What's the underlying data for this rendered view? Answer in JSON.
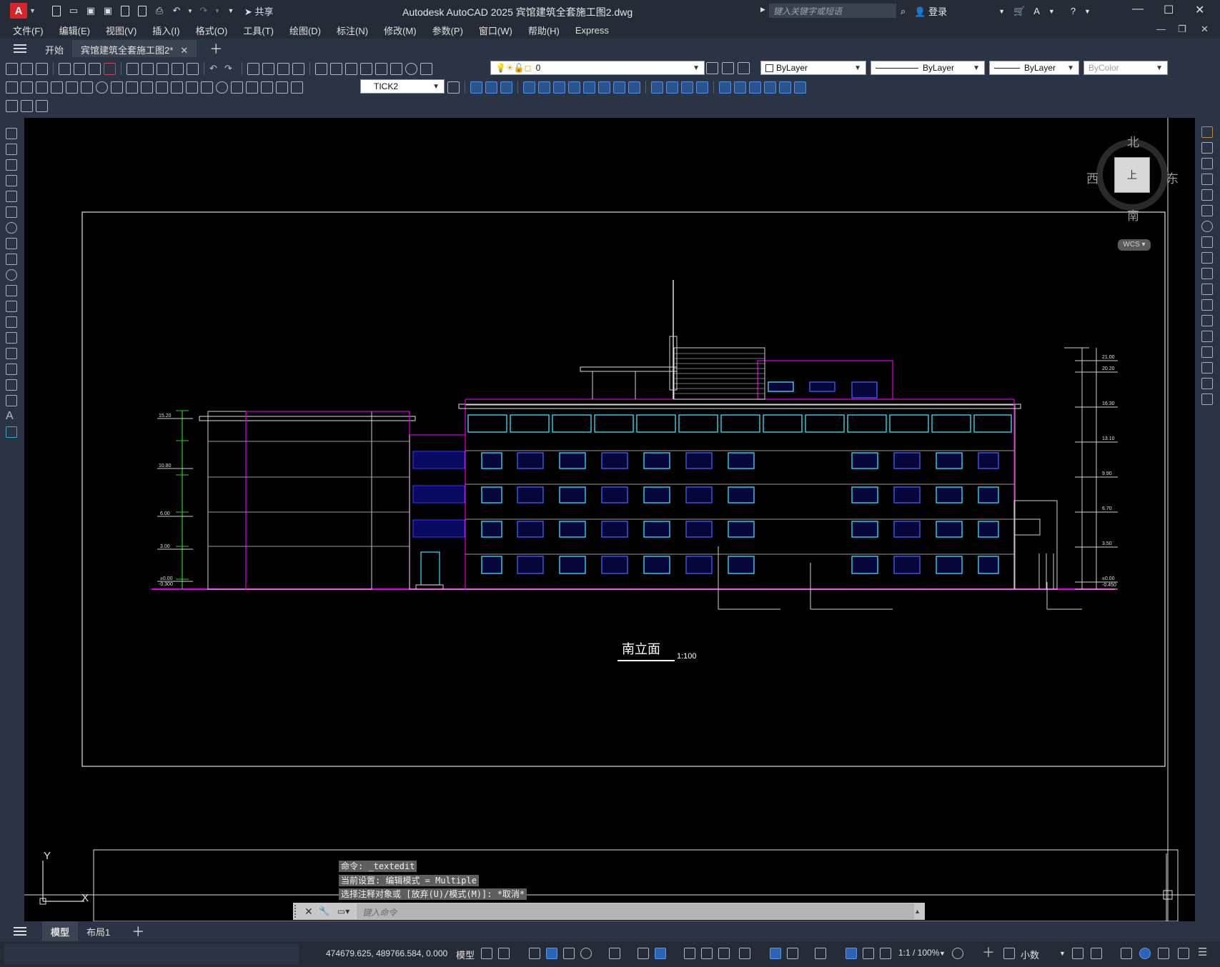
{
  "titlebar": {
    "app_logo": "A",
    "share": "共享",
    "title": "Autodesk AutoCAD 2025    宾馆建筑全套施工图2.dwg",
    "search_placeholder": "键入关键字或短语",
    "login": "登录"
  },
  "menu": [
    "文件(F)",
    "编辑(E)",
    "视图(V)",
    "插入(I)",
    "格式(O)",
    "工具(T)",
    "绘图(D)",
    "标注(N)",
    "修改(M)",
    "参数(P)",
    "窗口(W)",
    "帮助(H)",
    "Express"
  ],
  "tabs": {
    "start": "开始",
    "active_doc": "宾馆建筑全套施工图2*"
  },
  "properties": {
    "layer": "0",
    "color": "ByLayer",
    "linetype": "ByLayer",
    "lineweight": "ByLayer",
    "plotstyle": "ByColor",
    "dimstyle": "TICK2"
  },
  "viewcube": {
    "north": "北",
    "south": "南",
    "east": "东",
    "west": "西",
    "face": "上",
    "wcs": "WCS"
  },
  "drawing": {
    "title": "南立面",
    "scale": "1:100",
    "left_levels": [
      "15.20",
      "10.80",
      "6.00",
      "3.00",
      "±0.00",
      "-0.300"
    ],
    "right_levels": [
      "21.00",
      "20.20",
      "16.30",
      "13.10",
      "9.90",
      "6.70",
      "3.50",
      "±0.00",
      "-0.450"
    ]
  },
  "ucs": {
    "y": "Y",
    "x": "X"
  },
  "command": {
    "history": [
      "命令: _textedit",
      "当前设置: 编辑模式 = Multiple",
      "选择注释对象或 [放弃(U)/模式(M)]: *取消*"
    ],
    "placeholder": "键入命令"
  },
  "layouts": {
    "model": "模型",
    "layout1": "布局1"
  },
  "status": {
    "coords": "474679.625, 489766.584, 0.000",
    "model": "模型",
    "scale": "1:1 / 100%",
    "units": "小数"
  }
}
